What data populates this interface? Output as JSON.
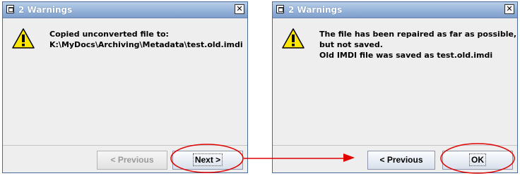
{
  "dialogs": [
    {
      "title": "2 Warnings",
      "close_glyph": "✕",
      "icon": "warning-icon",
      "message_lines": [
        "Copied unconverted file to:",
        "K:\\MyDocs\\Archiving\\Metadata\\test.old.imdi"
      ],
      "buttons": {
        "previous": "< Previous",
        "next": "Next >"
      }
    },
    {
      "title": "2 Warnings",
      "close_glyph": "✕",
      "icon": "warning-icon",
      "message_lines": [
        "The file has been repaired as far as possible,",
        "but not saved.",
        "Old IMDI file was saved as test.old.imdi"
      ],
      "buttons": {
        "previous": "< Previous",
        "ok": "OK"
      }
    }
  ],
  "annotation": {
    "color": "#e00000",
    "arrow": "Next > to OK"
  }
}
